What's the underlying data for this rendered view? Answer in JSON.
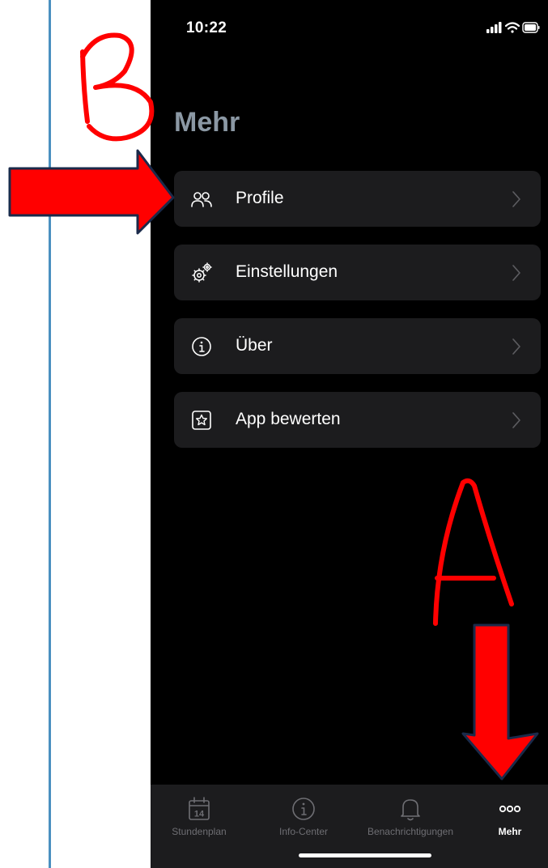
{
  "status_bar": {
    "time": "10:22"
  },
  "page": {
    "title": "Mehr"
  },
  "menu": {
    "items": [
      {
        "label": "Profile",
        "icon": "profile-icon"
      },
      {
        "label": "Einstellungen",
        "icon": "settings-gear-icon"
      },
      {
        "label": "Über",
        "icon": "info-icon"
      },
      {
        "label": "App bewerten",
        "icon": "star-rating-icon"
      }
    ]
  },
  "tab_bar": {
    "items": [
      {
        "label": "Stundenplan",
        "icon": "calendar-icon",
        "badge": "14",
        "active": false
      },
      {
        "label": "Info-Center",
        "icon": "info-icon",
        "active": false
      },
      {
        "label": "Benachrichtigungen",
        "icon": "bell-icon",
        "active": false
      },
      {
        "label": "Mehr",
        "icon": "more-dots-icon",
        "active": true
      }
    ]
  },
  "annotations": {
    "letter_a": "A",
    "letter_b": "B",
    "color": "#ff0000"
  }
}
